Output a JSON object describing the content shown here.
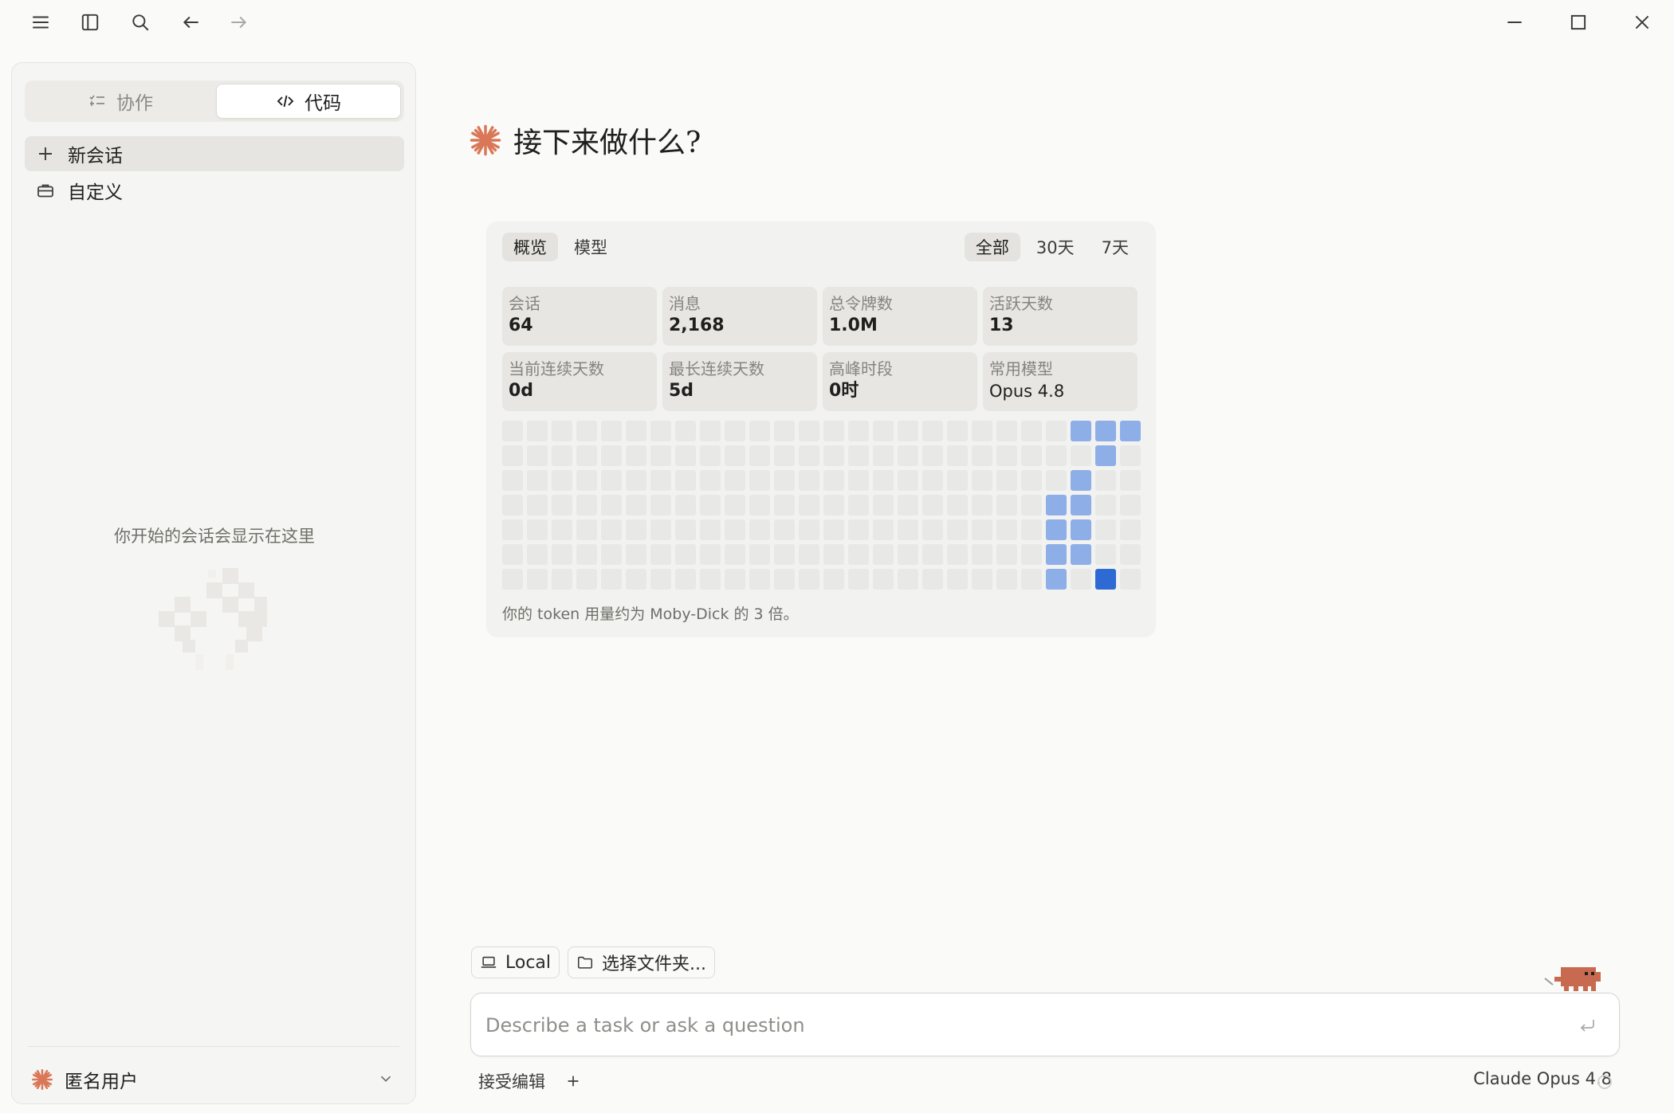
{
  "window": {
    "controls": [
      "menu-icon",
      "sidebar-toggle-icon",
      "search-icon",
      "back-arrow-icon",
      "forward-arrow-icon",
      "minimize-icon",
      "maximize-icon",
      "close-icon"
    ]
  },
  "sidebar": {
    "mode_tabs": [
      {
        "label": "协作",
        "icon": "tasks-icon",
        "selected": false
      },
      {
        "label": "代码",
        "icon": "code-icon",
        "selected": true
      }
    ],
    "items": [
      {
        "label": "新会话",
        "icon": "plus-icon"
      },
      {
        "label": "自定义",
        "icon": "briefcase-icon"
      }
    ],
    "empty_state": "你开始的会话会显示在这里",
    "user": {
      "name": "匿名用户",
      "icon": "claude-asterisk-icon"
    }
  },
  "main": {
    "greeting": "接下来做什么?",
    "accent": "#d97757"
  },
  "stats": {
    "view_tabs": [
      "概览",
      "模型"
    ],
    "range_tabs": [
      "全部",
      "30天",
      "7天"
    ],
    "metrics": [
      {
        "label": "会话",
        "value": "64"
      },
      {
        "label": "消息",
        "value": "2,168"
      },
      {
        "label": "总令牌数",
        "value": "1.0M"
      },
      {
        "label": "活跃天数",
        "value": "13"
      },
      {
        "label": "当前连续天数",
        "value": "0d"
      },
      {
        "label": "最长连续天数",
        "value": "5d"
      },
      {
        "label": "高峰时段",
        "value": "0时"
      },
      {
        "label": "常用模型",
        "value": "Opus 4.8"
      }
    ],
    "heatmap": {
      "columns": 26,
      "rows": 7,
      "active_cells": [
        {
          "col": 23,
          "row": 0,
          "level": 1
        },
        {
          "col": 24,
          "row": 0,
          "level": 1
        },
        {
          "col": 25,
          "row": 0,
          "level": 1
        },
        {
          "col": 24,
          "row": 1,
          "level": 1
        },
        {
          "col": 23,
          "row": 2,
          "level": 1
        },
        {
          "col": 22,
          "row": 3,
          "level": 1
        },
        {
          "col": 23,
          "row": 3,
          "level": 1
        },
        {
          "col": 22,
          "row": 4,
          "level": 1
        },
        {
          "col": 23,
          "row": 4,
          "level": 1
        },
        {
          "col": 22,
          "row": 5,
          "level": 1
        },
        {
          "col": 23,
          "row": 5,
          "level": 1
        },
        {
          "col": 22,
          "row": 6,
          "level": 1
        },
        {
          "col": 24,
          "row": 6,
          "level": 2
        }
      ],
      "last_col_rows": 7,
      "colors": {
        "empty": "#e8e8e6",
        "low": "#8eaee8",
        "high": "#2d6ad3"
      }
    },
    "caption": "你的 token 用量约为 Moby-Dick 的 3 倍。"
  },
  "composer": {
    "env_label": "Local",
    "folder_label": "选择文件夹...",
    "placeholder": "Describe a task or ask a question",
    "mode_label": "接受编辑",
    "model_label": "Claude Opus 4.8"
  }
}
